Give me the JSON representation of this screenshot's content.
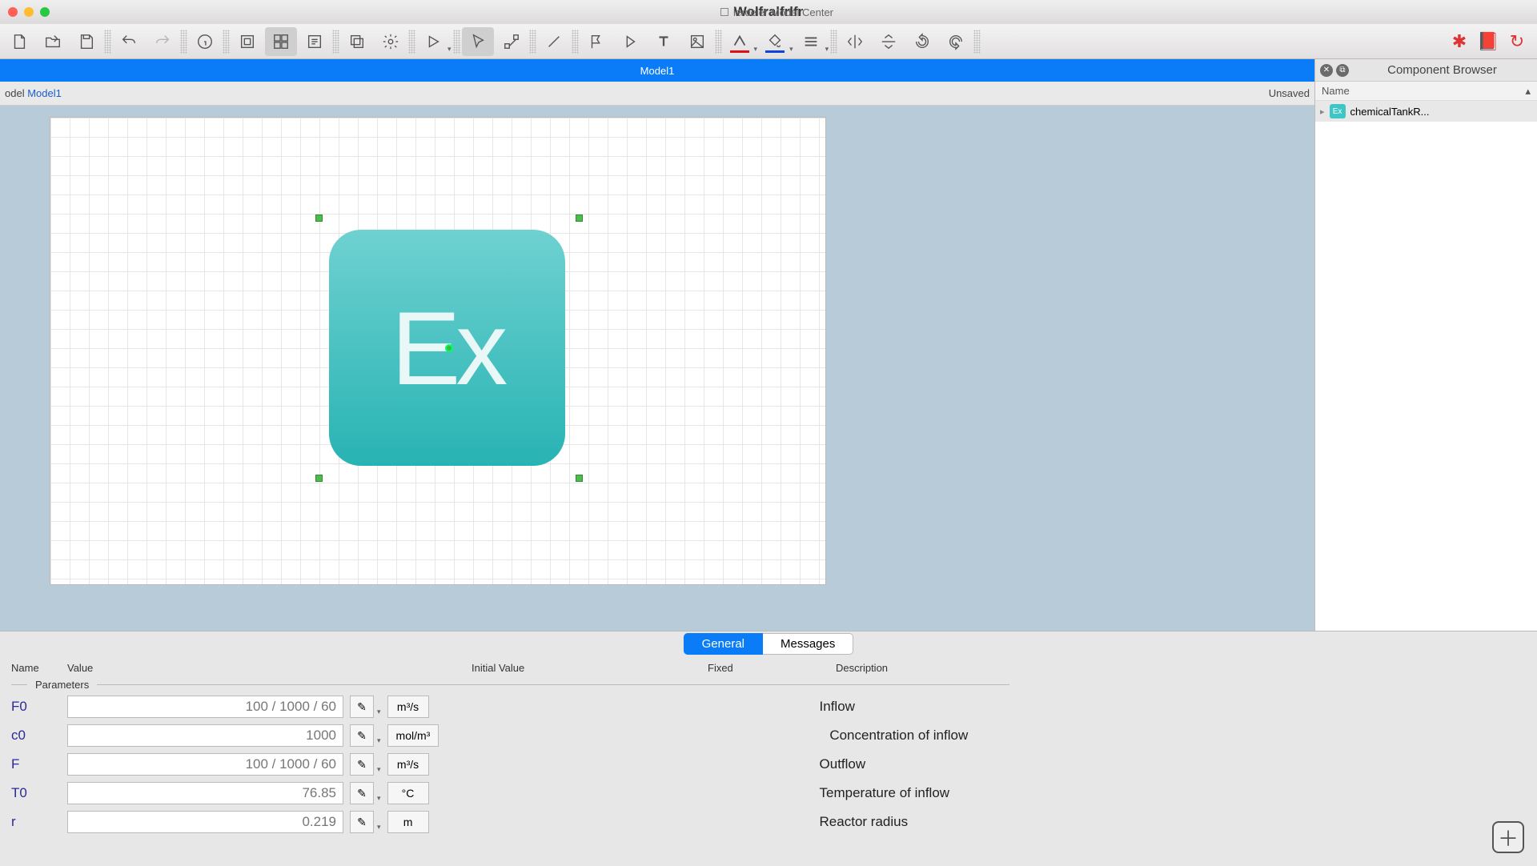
{
  "titlebar": {
    "app_title": "Wolfralfrlfr",
    "sub_title": "lerdeler Model Center"
  },
  "tab": {
    "label": "Model1"
  },
  "model_path": {
    "prefix": "odel",
    "name": "Model1",
    "status": "Unsaved"
  },
  "component_browser": {
    "title": "Component Browser",
    "col_header": "Name",
    "items": [
      {
        "label": "chemicalTankR..."
      }
    ]
  },
  "canvas": {
    "component_label": "Ex"
  },
  "bottom_tabs": {
    "general": "General",
    "messages": "Messages"
  },
  "columns": {
    "name": "Name",
    "value": "Value",
    "initial": "Initial Value",
    "fixed": "Fixed",
    "desc": "Description"
  },
  "section": {
    "parameters": "Parameters"
  },
  "params": [
    {
      "name": "F0",
      "value": "100 / 1000 / 60",
      "unit": "m³/s",
      "desc": "Inflow"
    },
    {
      "name": "c0",
      "value": "1000",
      "unit": "mol/m³",
      "desc": "Concentration of inflow"
    },
    {
      "name": "F",
      "value": "100 / 1000 / 60",
      "unit": "m³/s",
      "desc": "Outflow"
    },
    {
      "name": "T0",
      "value": "76.85",
      "unit": "°C",
      "desc": "Temperature of inflow"
    },
    {
      "name": "r",
      "value": "0.219",
      "unit": "m",
      "desc": "Reactor radius"
    }
  ]
}
